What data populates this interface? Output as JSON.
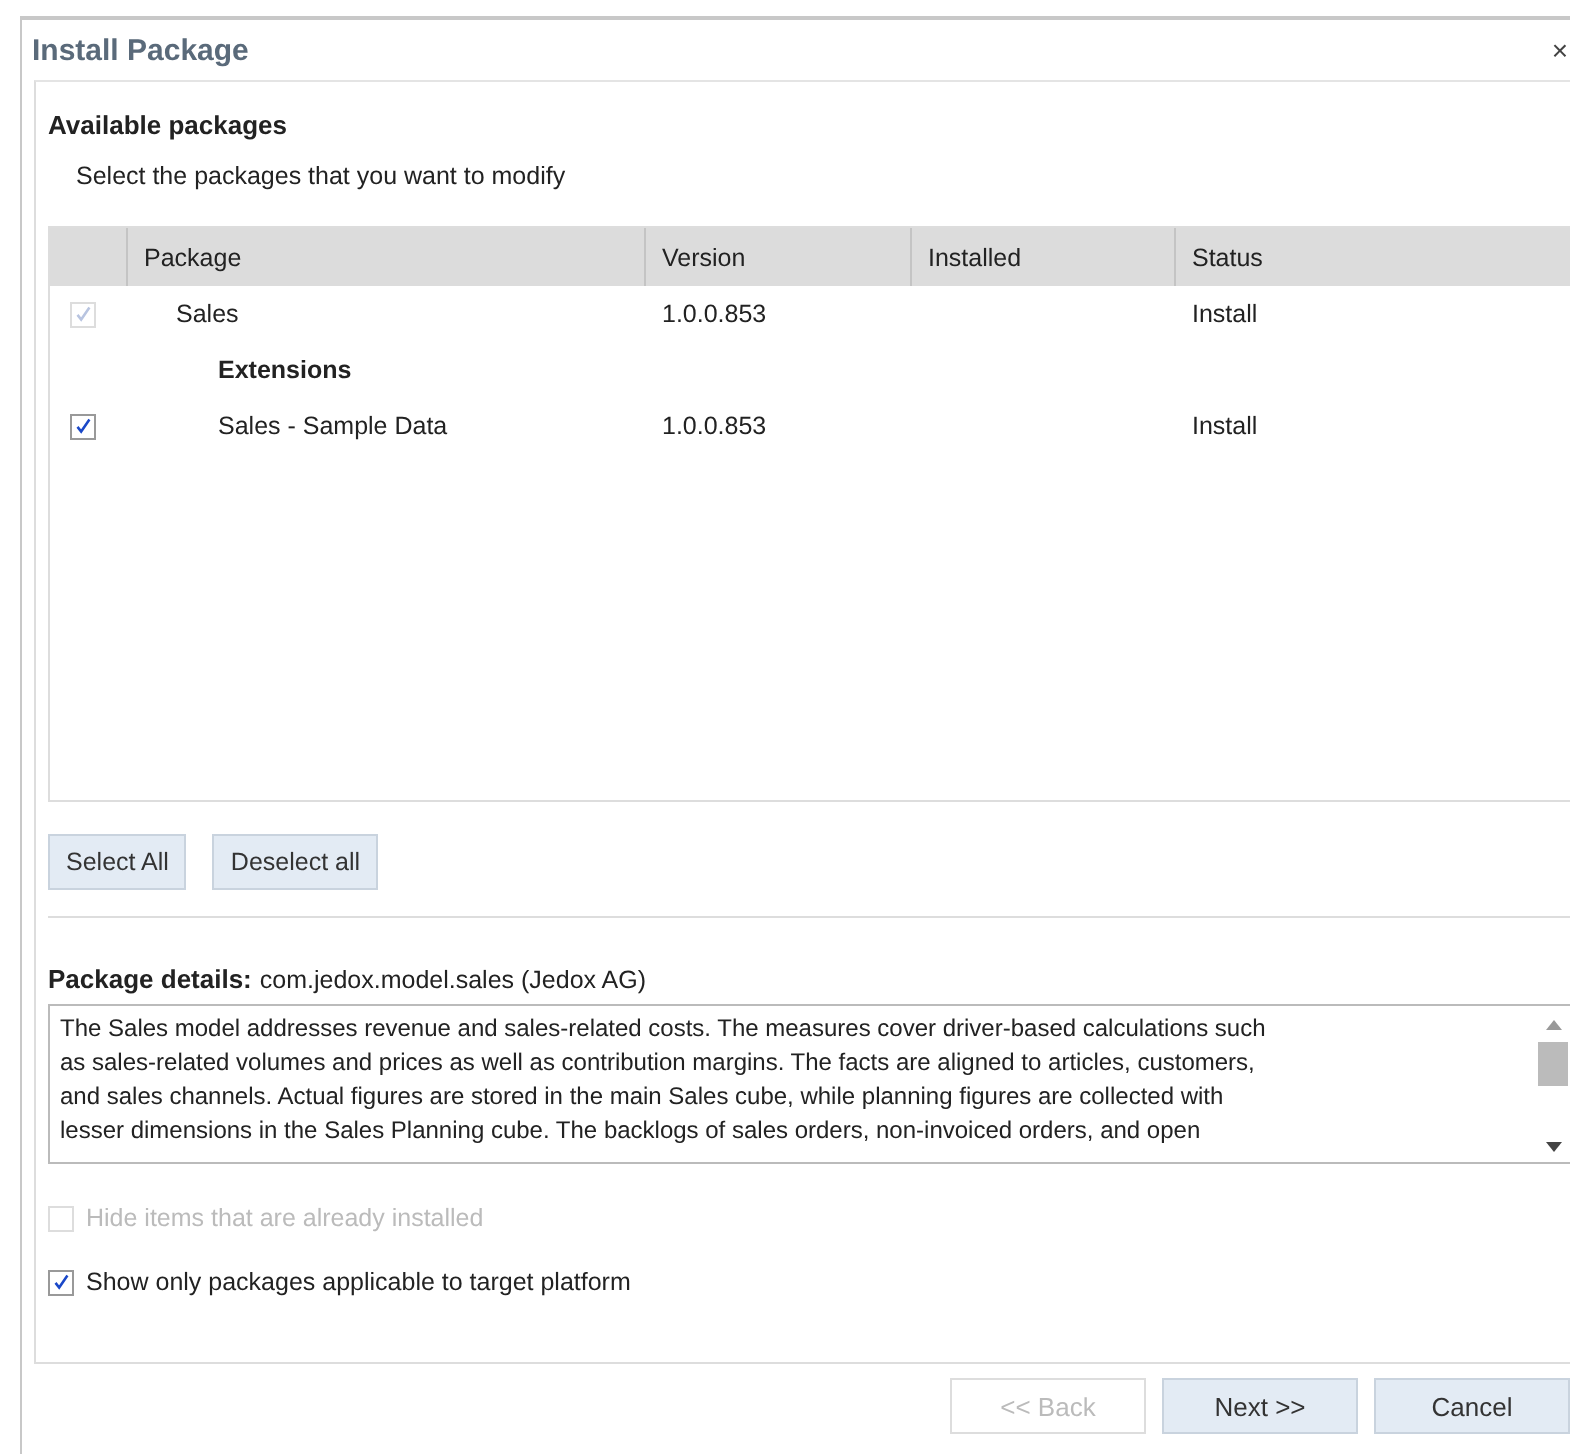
{
  "window": {
    "title": "Install Package",
    "close": "×"
  },
  "section_title": "Available packages",
  "instruction": "Select the packages that you want to modify",
  "table": {
    "columns": [
      "Package",
      "Version",
      "Installed",
      "Status"
    ],
    "rows": [
      {
        "kind": "item",
        "name": "Sales",
        "version": "1.0.0.853",
        "status": "Install",
        "checked": true,
        "disabled": true
      },
      {
        "kind": "group",
        "name": "Extensions",
        "children": [
          {
            "kind": "item",
            "name": "Sales - Sample Data",
            "version": "1.0.0.853",
            "status": "Install",
            "checked": true,
            "disabled": false
          }
        ]
      }
    ]
  },
  "selection_buttons": [
    "Select All",
    "Deselect all"
  ],
  "details": {
    "label": "Package details:",
    "package": "com.jedox.model.sales (Jedox AG)",
    "description_lines": [
      "The Sales model addresses revenue and sales-related costs. The measures cover driver-based calculations such",
      "as sales-related volumes and prices as well as contribution margins. The facts are aligned to articles, customers,",
      "and sales channels. Actual figures are stored in the main Sales cube, while planning figures are collected with",
      "lesser dimensions in the Sales Planning cube. The backlogs of sales orders, non-invoiced orders, and open"
    ]
  },
  "options": [
    {
      "label": "Hide items that are already installed",
      "checked": false,
      "disabled": true
    },
    {
      "label": "Show only packages applicable to target platform",
      "checked": true,
      "disabled": false
    }
  ],
  "footer_buttons": [
    {
      "label": "<< Back",
      "disabled": true
    },
    {
      "label": "Next >>",
      "disabled": false
    },
    {
      "label": "Cancel",
      "disabled": false
    }
  ]
}
